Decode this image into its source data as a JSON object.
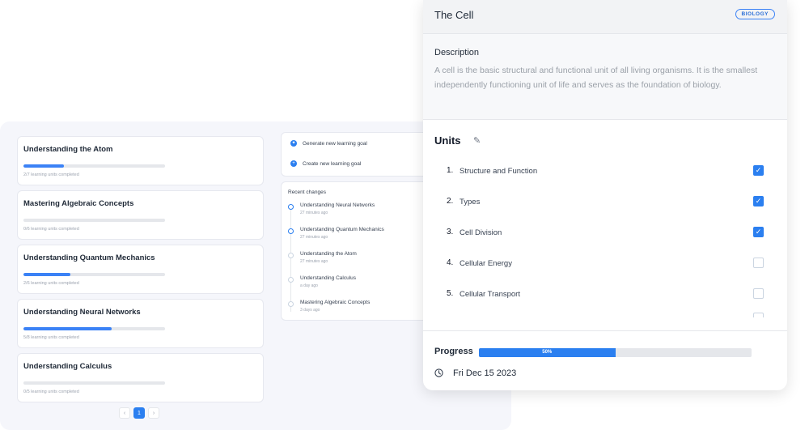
{
  "dashboard": {
    "goals": [
      {
        "title": "Understanding the Atom",
        "subtitle": "2/7 learning units completed",
        "progress": 0.286
      },
      {
        "title": "Mastering Algebraic Concepts",
        "subtitle": "0/6 learning units completed",
        "progress": 0
      },
      {
        "title": "Understanding Quantum Mechanics",
        "subtitle": "2/6 learning units completed",
        "progress": 0.333
      },
      {
        "title": "Understanding Neural Networks",
        "subtitle": "5/8 learning units completed",
        "progress": 0.625
      },
      {
        "title": "Understanding Calculus",
        "subtitle": "0/5 learning units completed",
        "progress": 0
      }
    ],
    "pagination": {
      "prev": "‹",
      "current": "1",
      "next": "›"
    },
    "actions": {
      "generate": "Generate new learning goal",
      "create": "Create new learning goal"
    },
    "recent_changes": {
      "heading": "Recent changes",
      "items": [
        {
          "title": "Understanding Neural Networks",
          "time": "27 minutes ago"
        },
        {
          "title": "Understanding Quantum Mechanics",
          "time": "27 minutes ago"
        },
        {
          "title": "Understanding the Atom",
          "time": "27 minutes ago"
        },
        {
          "title": "Understanding Calculus",
          "time": "a day ago"
        },
        {
          "title": "Mastering Algebraic Concepts",
          "time": "3 days ago"
        }
      ]
    }
  },
  "detail": {
    "title": "The Cell",
    "badge": "BIOLOGY",
    "description_label": "Description",
    "description": "A cell is the basic structural and functional unit of all living organisms. It is the smallest independently functioning unit of life and serves as the foundation of biology.",
    "units_heading": "Units",
    "units": [
      {
        "num": "1.",
        "name": "Structure and Function",
        "done": true
      },
      {
        "num": "2.",
        "name": "Types",
        "done": true
      },
      {
        "num": "3.",
        "name": "Cell Division",
        "done": true
      },
      {
        "num": "4.",
        "name": "Cellular Energy",
        "done": false
      },
      {
        "num": "5.",
        "name": "Cellular Transport",
        "done": false
      }
    ],
    "progress_label": "Progress",
    "progress_value": 0.5,
    "progress_text": "50%",
    "date": "Fri Dec 15 2023"
  },
  "icons": {
    "edit": "pencil-icon",
    "clock": "clock-icon",
    "checkbox_checked": "check-icon"
  },
  "colors": {
    "accent": "#2b7ff0",
    "badge": "#3b82f6"
  }
}
